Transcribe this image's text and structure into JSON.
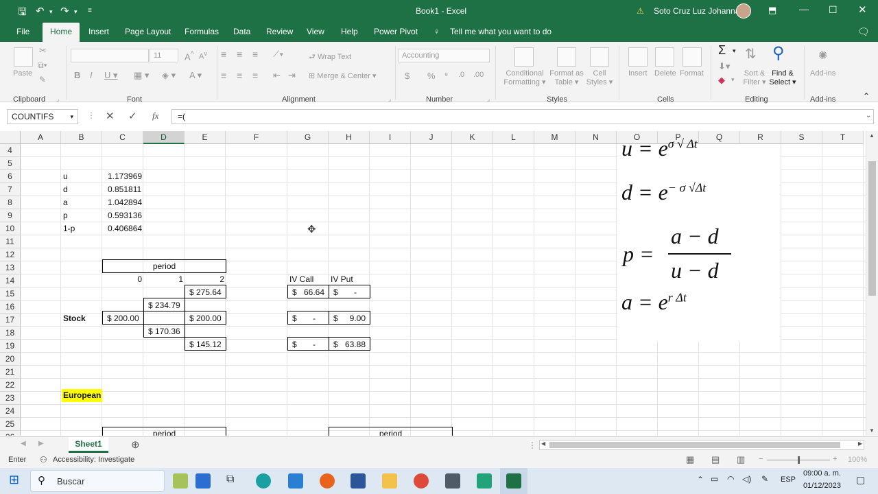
{
  "app": {
    "title": "Book1  -  Excel",
    "user": "Soto Cruz Luz Johanna"
  },
  "tabs": [
    "File",
    "Home",
    "Insert",
    "Page Layout",
    "Formulas",
    "Data",
    "Review",
    "View",
    "Help",
    "Power Pivot"
  ],
  "tell_me": "Tell me what you want to do",
  "ribbon": {
    "clipboard": {
      "label": "Clipboard",
      "paste": "Paste"
    },
    "font": {
      "label": "Font",
      "size": "11"
    },
    "alignment": {
      "label": "Alignment",
      "wrap": "Wrap Text",
      "merge": "Merge & Center"
    },
    "number": {
      "label": "Number",
      "format": "Accounting",
      "currency": "$",
      "percent": "%"
    },
    "styles": {
      "label": "Styles",
      "conditional": [
        "Conditional",
        "Formatting"
      ],
      "format_table": [
        "Format as",
        "Table"
      ],
      "cell_styles": [
        "Cell",
        "Styles"
      ]
    },
    "cells": {
      "label": "Cells",
      "insert": "Insert",
      "delete": "Delete",
      "format": "Format"
    },
    "editing": {
      "label": "Editing",
      "sort": [
        "Sort &",
        "Filter"
      ],
      "find": [
        "Find &",
        "Select"
      ]
    },
    "addins": {
      "label": "Add-ins",
      "btn": "Add-ins"
    }
  },
  "formula_bar": {
    "name_box": "COUNTIFS",
    "formula": "=("
  },
  "columns": [
    "A",
    "B",
    "C",
    "D",
    "E",
    "F",
    "G",
    "H",
    "I",
    "J",
    "K",
    "L",
    "M",
    "N",
    "O",
    "P",
    "Q",
    "R",
    "S",
    "T"
  ],
  "rows": [
    "4",
    "5",
    "6",
    "7",
    "8",
    "9",
    "10",
    "11",
    "12",
    "13",
    "14",
    "15",
    "16",
    "17",
    "18",
    "19",
    "20",
    "21",
    "22",
    "23",
    "24",
    "25",
    "26"
  ],
  "cells": {
    "B6": "u",
    "C6": "1.173969",
    "B7": "d",
    "C7": "0.851811",
    "B8": "a",
    "C8": "1.042894",
    "B9": "p",
    "C9": "0.593136",
    "B10": "1-p",
    "C10": "0.406864",
    "period": "period",
    "C14": "0",
    "D14": "1",
    "E14": "2",
    "G14": "IV Call",
    "H14": "IV Put",
    "E15": "$ 275.64",
    "G15a": "$",
    "G15b": "66.64",
    "H15a": "$",
    "H15b": "-",
    "D16": "$ 234.79",
    "B17": "Stock",
    "C17": "$ 200.00",
    "E17": "$ 200.00",
    "G17a": "$",
    "G17b": "-",
    "H17a": "$",
    "H17b": "9.00",
    "D18": "$ 170.36",
    "E19": "$ 145.12",
    "G19a": "$",
    "G19b": "-",
    "H19a": "$",
    "H19b": "63.88",
    "B23": "European",
    "C26": "period",
    "H26": "period"
  },
  "equations": {
    "u": "u = e",
    "u_exp": "σ √ Δt",
    "d": "d = e",
    "d_exp": "− σ √Δt",
    "p_lhs": "p =",
    "p_num": "a − d",
    "p_den": "u − d",
    "a": "a = e",
    "a_exp": "r Δt"
  },
  "sheet_tab": "Sheet1",
  "status": {
    "mode": "Enter",
    "accessibility": "Accessibility: Investigate",
    "zoom": "100%"
  },
  "taskbar": {
    "search": "Buscar",
    "lang": "ESP",
    "time": "09:00 a. m.",
    "date": "01/12/2023"
  },
  "colors": {
    "excel_green": "#1e7145",
    "highlight": "#ffff00"
  }
}
